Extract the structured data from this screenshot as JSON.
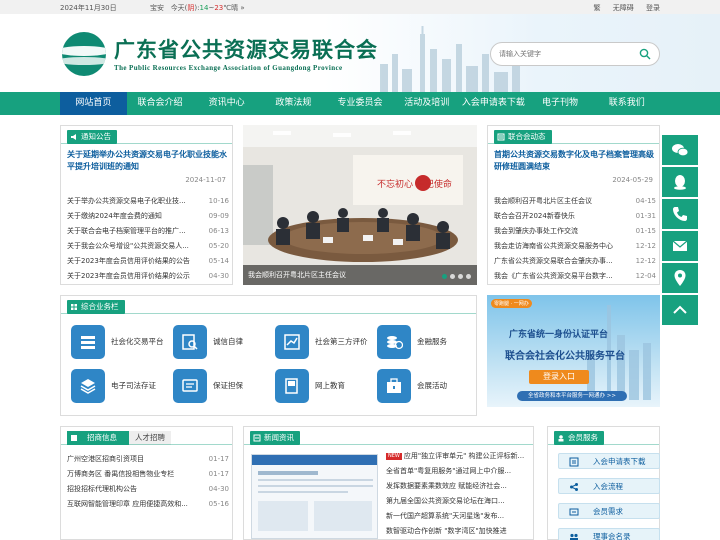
{
  "topbar": {
    "date": "2024年11月30日",
    "city": "宝安",
    "weather_prefix": "今天(",
    "weather_cond": "阴",
    "weather_mid": "):",
    "temp_low": "14",
    "temp_sep": "~",
    "temp_high": "23",
    "temp_unit": "℃",
    "more": "晴 »",
    "links": [
      "繁",
      "无障碍",
      "登录"
    ]
  },
  "header": {
    "title": "广东省公共资源交易联合会",
    "subtitle": "The Public Resources Exchange Association of Guangdong Province",
    "search_placeholder": "请输入关键字"
  },
  "nav": [
    "网站首页",
    "联合会介绍",
    "资讯中心",
    "政策法规",
    "专业委员会",
    "活动及培训",
    "入会申请表下载",
    "电子刊物",
    "联系我们"
  ],
  "notice": {
    "title": "通知公告",
    "headline": "关于延期举办公共资源交易电子化职业技能水平提升培训班的通知",
    "headline_date": "2024-11-07",
    "items": [
      {
        "title": "关于举办公共资源交易电子化职业技...",
        "date": "10-16"
      },
      {
        "title": "关于缴纳2024年度会费的通知",
        "date": "09-09"
      },
      {
        "title": "关于联合会电子档案管理平台的推广...",
        "date": "06-13"
      },
      {
        "title": "关于我会公众号增设\"公共资源交易人...",
        "date": "05-20"
      },
      {
        "title": "关于2023年度会员信用评价结果的公告",
        "date": "05-14"
      },
      {
        "title": "关于2023年度会员信用评价结果的公示",
        "date": "04-30"
      }
    ]
  },
  "photo": {
    "caption": "我会顺利召开粤北片区主任会议",
    "wall_text": "不忘初心 牢记使命"
  },
  "dynamics": {
    "title": "联合会动态",
    "headline": "首期公共资源交易数字化及电子档案管理高级研修班圆满结束",
    "headline_date": "2024-05-29",
    "items": [
      {
        "title": "我会顺利召开粤北片区主任会议",
        "date": "04-15"
      },
      {
        "title": "联合会召开2024新春快乐",
        "date": "01-31"
      },
      {
        "title": "我会到肇庆办事处工作交流",
        "date": "01-15"
      },
      {
        "title": "我会走访海南省公共资源交易服务中心",
        "date": "12-12"
      },
      {
        "title": "广东省公共资源交易联合会肇庆办事...",
        "date": "12-12"
      },
      {
        "title": "我会《广东省公共资源交易平台数字...",
        "date": "12-04"
      }
    ]
  },
  "business": {
    "title": "综合业务栏",
    "items": [
      {
        "label": "社会化交易平台",
        "icon": "platform-icon"
      },
      {
        "label": "诚信自律",
        "icon": "credit-search-icon"
      },
      {
        "label": "社会第三方评价",
        "icon": "evaluation-icon"
      },
      {
        "label": "金融服务",
        "icon": "finance-icon"
      },
      {
        "label": "电子司法存证",
        "icon": "evidence-icon"
      },
      {
        "label": "保证担保",
        "icon": "guarantee-icon"
      },
      {
        "label": "网上教育",
        "icon": "education-icon"
      },
      {
        "label": "会展活动",
        "icon": "exhibition-icon"
      }
    ]
  },
  "banner": {
    "tag": "零跑腿 · 一网办",
    "line1": "广东省统一身份认证平台",
    "line2": "联合会社会化公共服务平台",
    "button": "登录入口",
    "footer": "全省政务和本平台服务一网通办 >>"
  },
  "recruit": {
    "tabs": [
      "招商信息",
      "人才招聘"
    ],
    "items": [
      {
        "title": "广州空港区招商引资项目",
        "date": "01-17"
      },
      {
        "title": "万博商务区 番禺信投相售物业专栏",
        "date": "01-17"
      },
      {
        "title": "招投招标代理机构公告",
        "date": "04-30"
      },
      {
        "title": "互联网智能管理印章 应用便捷高效和...",
        "date": "05-16"
      }
    ]
  },
  "news": {
    "title": "新闻资讯",
    "badge": "NEW",
    "items": [
      "应用\"独立评审单元\" 构建公正评标新...",
      "全省首单\"粤复用服务\"通过网上中介服...",
      "发挥数据要素乘数效应 赋能经济社会...",
      "第九届全国公共资源交易论坛在海口...",
      "新一代国产超算系统\"天河星逸\"发布...",
      "数智驱动合作创新 \"数字湾区\"加快推进"
    ]
  },
  "member": {
    "title": "会员服务",
    "items": [
      {
        "label": "入会申请表下载",
        "icon": "download-icon"
      },
      {
        "label": "入会流程",
        "icon": "flow-icon"
      },
      {
        "label": "会员需求",
        "icon": "demand-icon"
      },
      {
        "label": "理事会名录",
        "icon": "directory-icon"
      }
    ]
  },
  "floatbar": [
    "wechat-icon",
    "qq-icon",
    "phone-icon",
    "mail-icon",
    "location-icon",
    "back-to-top-icon"
  ],
  "colors": {
    "primary": "#17a17f",
    "nav_active": "#0d5e9e",
    "tile_blue": "#2f86c6",
    "banner_button": "#ef8a1d"
  }
}
